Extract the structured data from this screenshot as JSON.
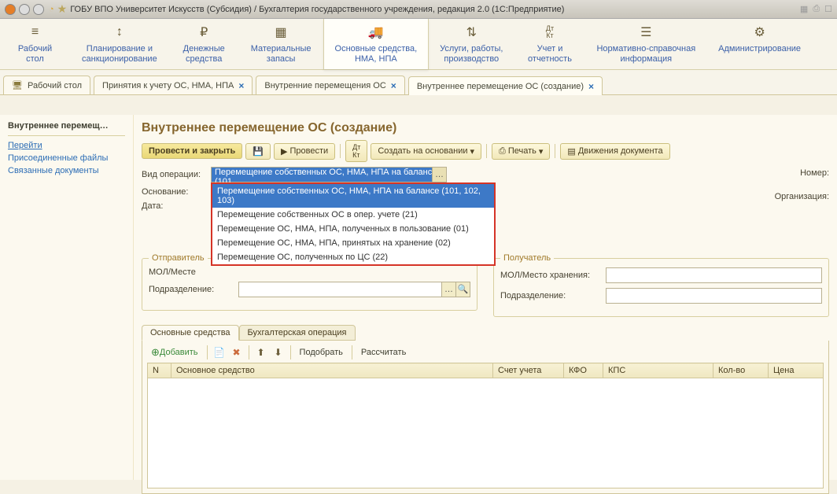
{
  "window": {
    "title": "ГОБУ ВПО Университет Искусств (Субсидия) / Бухгалтерия государственного учреждения, редакция 2.0  (1С:Предприятие)"
  },
  "mainMenu": [
    {
      "label": "Рабочий\nстол",
      "icon": "≡"
    },
    {
      "label": "Планирование и\nсанкционирование",
      "icon": "↕"
    },
    {
      "label": "Денежные\nсредства",
      "icon": "₽"
    },
    {
      "label": "Материальные\nзапасы",
      "icon": "▦"
    },
    {
      "label": "Основные средства,\nНМА, НПА",
      "icon": "🚚",
      "active": true
    },
    {
      "label": "Услуги, работы,\nпроизводство",
      "icon": "⇅"
    },
    {
      "label": "Учет и\nотчетность",
      "icon": "Дт\nКт"
    },
    {
      "label": "Нормативно-справочная\nинформация",
      "icon": "☰"
    },
    {
      "label": "Администрирование",
      "icon": "⚙"
    }
  ],
  "tabs": [
    {
      "label": "Рабочий стол",
      "hasIcon": true
    },
    {
      "label": "Принятия к учету ОС, НМА, НПА",
      "closable": true
    },
    {
      "label": "Внутренние перемещения ОС",
      "closable": true
    },
    {
      "label": "Внутреннее перемещение ОС (создание)",
      "closable": true,
      "active": true
    }
  ],
  "side": {
    "title": "Внутреннее перемещ…",
    "goLabel": "Перейти",
    "links": [
      "Присоединенные файлы",
      "Связанные документы"
    ]
  },
  "pageTitle": "Внутреннее перемещение ОС (создание)",
  "toolbar": {
    "main": "Провести и закрыть",
    "post": "Провести",
    "createBy": "Создать на основании",
    "print": "Печать",
    "moves": "Движения документа"
  },
  "form": {
    "opLabel": "Вид операции:",
    "opValue": "Перемещение собственных ОС, НМА, НПА на балансе (101…",
    "options": [
      "Перемещение собственных ОС, НМА, НПА на балансе (101, 102, 103)",
      "Перемещение собственных ОС в опер. учете (21)",
      "Перемещение ОС, НМА, НПА, полученных в пользование (01)",
      "Перемещение ОС, НМА, НПА, принятых на хранение (02)",
      "Перемещение ОС, полученных по ЦС (22)"
    ],
    "basisLabel": "Основание:",
    "dateLabel": "Дата:",
    "numberLabel": "Номер:",
    "orgLabel": "Организация:"
  },
  "sender": {
    "legend": "Отправитель",
    "molLabel": "МОЛ/Месте",
    "divLabel": "Подразделение:"
  },
  "receiver": {
    "legend": "Получатель",
    "molLabel": "МОЛ/Место хранения:",
    "divLabel": "Подразделение:"
  },
  "subTabs": [
    "Основные средства",
    "Бухгалтерская операция"
  ],
  "tblToolbar": {
    "add": "Добавить",
    "select": "Подобрать",
    "calc": "Рассчитать"
  },
  "columns": [
    "N",
    "Основное средство",
    "Счет учета",
    "КФО",
    "КПС",
    "Кол-во",
    "Цена"
  ]
}
